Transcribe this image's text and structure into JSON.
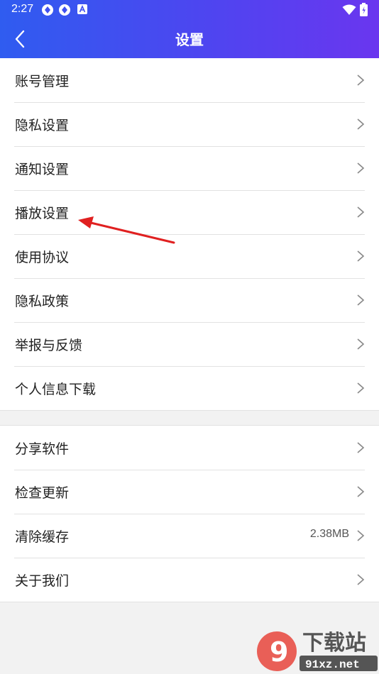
{
  "status_bar": {
    "time": "2:27"
  },
  "header": {
    "title": "设置"
  },
  "groups": [
    {
      "items": [
        {
          "label": "账号管理"
        },
        {
          "label": "隐私设置"
        },
        {
          "label": "通知设置"
        },
        {
          "label": "播放设置"
        },
        {
          "label": "使用协议"
        },
        {
          "label": "隐私政策"
        },
        {
          "label": "举报与反馈"
        },
        {
          "label": "个人信息下载"
        }
      ]
    },
    {
      "items": [
        {
          "label": "分享软件"
        },
        {
          "label": "检查更新"
        },
        {
          "label": "清除缓存",
          "value": "2.38MB"
        },
        {
          "label": "关于我们"
        }
      ]
    }
  ],
  "watermark": {
    "text": "下载站",
    "url": "91xz.net",
    "number": "9"
  },
  "colors": {
    "header_start": "#2f5cf0",
    "header_end": "#6a36ef",
    "annotation_arrow": "#e02020"
  }
}
